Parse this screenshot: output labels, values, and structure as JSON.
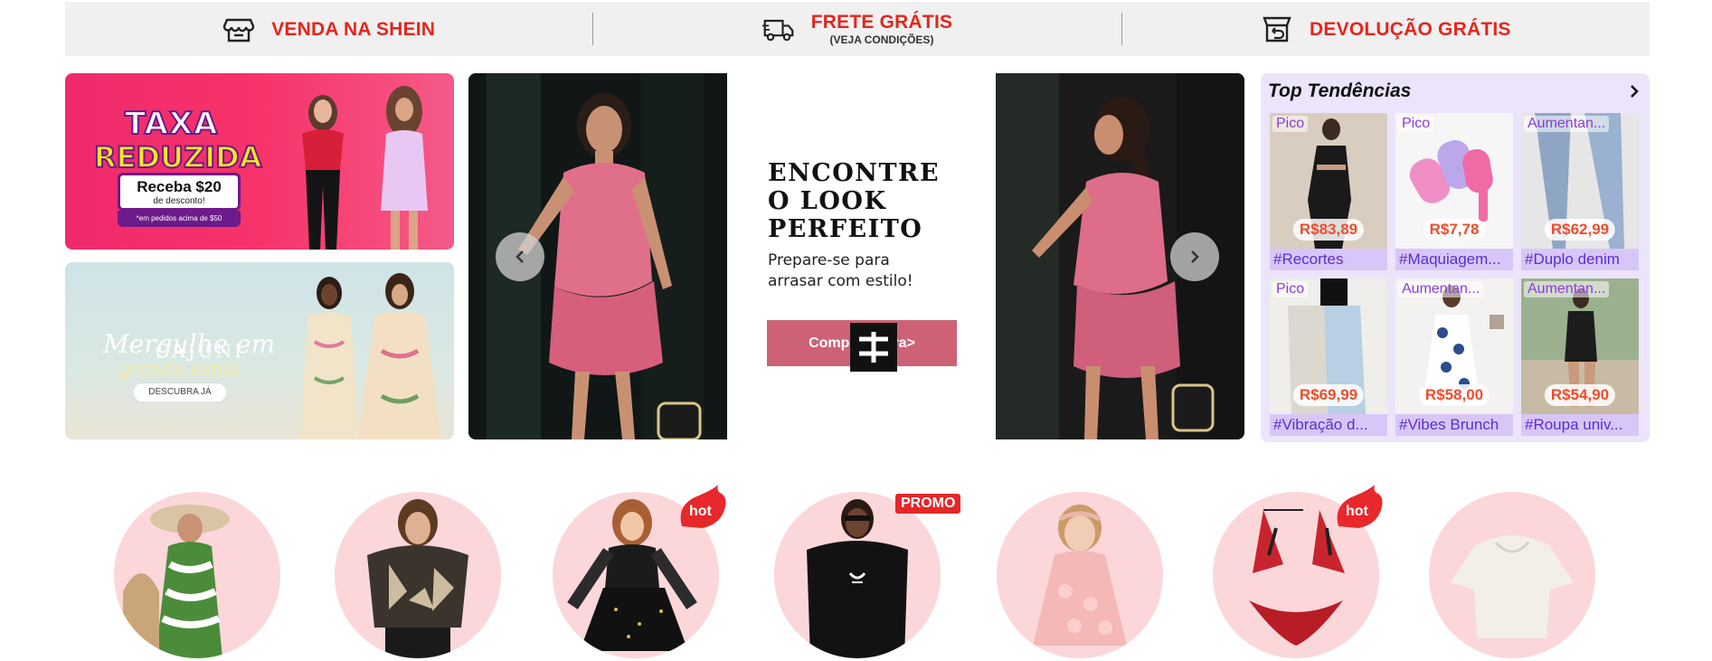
{
  "service_bar": {
    "sell": {
      "label": "VENDA NA SHEIN",
      "icon": "store-icon"
    },
    "shipping": {
      "label": "FRETE GRÁTIS",
      "sub": "(VEJA CONDIÇÕES)",
      "icon": "truck-icon"
    },
    "returns": {
      "label": "DEVOLUÇÃO GRÁTIS",
      "icon": "return-box-icon"
    },
    "accent_color": "#e2271f"
  },
  "promo_banner": {
    "line1": "TAXA",
    "line2": "REDUZIDA",
    "offer": "Receba $20",
    "offer_sub": "de desconto!",
    "footnote": "*em pedidos acima de $50"
  },
  "cajuni_banner": {
    "brand": "CAJUNI",
    "line1": "Mergulhe em",
    "line2": "grande estilo",
    "button": "DESCUBRA JÁ"
  },
  "hero": {
    "headline_1": "ENCONTRE",
    "headline_2": "O LOOK",
    "headline_3": "PERFEITO",
    "subtitle_1": "Prepare-se para",
    "subtitle_2": "arrasar com estilo!",
    "cta": "Compre agora>",
    "prev_icon": "chevron-left-icon",
    "next_icon": "chevron-right-icon"
  },
  "trends": {
    "title": "Top Tendências",
    "more_icon": "chevron-right-icon",
    "items": [
      {
        "badge": "Pico",
        "price": "R$83,89",
        "tag": "#Recortes"
      },
      {
        "badge": "Pico",
        "price": "R$7,78",
        "tag": "#Maquiagem..."
      },
      {
        "badge": "Aumentan...",
        "price": "R$62,99",
        "tag": "#Duplo denim"
      },
      {
        "badge": "Pico",
        "price": "R$69,99",
        "tag": "#Vibração d..."
      },
      {
        "badge": "Aumentan...",
        "price": "R$58,00",
        "tag": "#Vibes Brunch"
      },
      {
        "badge": "Aumentan...",
        "price": "R$54,90",
        "tag": "#Roupa univ..."
      }
    ]
  },
  "categories": {
    "hot_label": "hot",
    "promo_label": "PROMO"
  }
}
